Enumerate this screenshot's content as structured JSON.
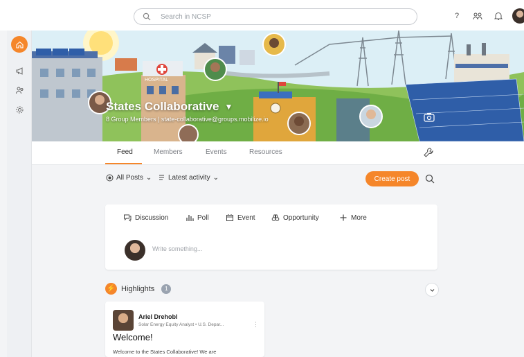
{
  "search": {
    "placeholder": "Search in NCSP"
  },
  "topbar": {
    "help_label": "?"
  },
  "group": {
    "title": "States Collaborative",
    "subtitle": "8 Group Members | state-collaborative@groups.mobilize.io"
  },
  "banner": {
    "hospital_sign": "HOSPITAL"
  },
  "tabs": [
    {
      "label": "Feed"
    },
    {
      "label": "Members"
    },
    {
      "label": "Events"
    },
    {
      "label": "Resources"
    }
  ],
  "filters": {
    "posts": "All Posts",
    "sort": "Latest activity",
    "create_post": "Create post"
  },
  "composer": {
    "types": [
      {
        "label": "Discussion"
      },
      {
        "label": "Poll"
      },
      {
        "label": "Event"
      },
      {
        "label": "Opportunity"
      },
      {
        "label": "More"
      }
    ],
    "placeholder": "Write something..."
  },
  "highlights": {
    "label": "Highlights",
    "count": "1",
    "card": {
      "author": "Ariel Drehobl",
      "role": "Solar Energy Equity Analyst • U.S. Depar...",
      "title": "Welcome!",
      "body": "Welcome to the States Collaborative! We are"
    }
  },
  "colors": {
    "accent": "#f5862a",
    "rail": "#eef0f3",
    "background": "#f3f4f6"
  }
}
